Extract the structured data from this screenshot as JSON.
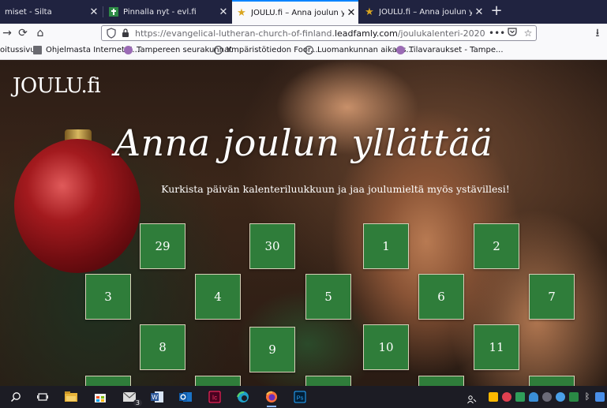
{
  "browser": {
    "tabs": [
      {
        "title": "miset - Silta",
        "icon": "tab-favicon-icon",
        "close": "✕",
        "active": false
      },
      {
        "title": "Pinnalla nyt - evl.fi",
        "icon": "cross-favicon-icon",
        "close": "✕",
        "active": false
      },
      {
        "title": "JOULU.fi – Anna joulun yllättää",
        "icon": "star-favicon-icon",
        "close": "✕",
        "active": true
      },
      {
        "title": "JOULU.fi – Anna joulun yllättää",
        "icon": "star-favicon-icon",
        "close": "✕",
        "active": false
      }
    ],
    "new_tab": "+",
    "url_prefix": "https://evangelical-lutheran-church-of-finland.",
    "url_domain": "leadfamly.com",
    "url_path": "/joulukalenteri-2020",
    "url_more": "•••",
    "bookmarks": [
      {
        "label": "oitussivu",
        "icon": "none"
      },
      {
        "label": "Ohjelmasta Internet E...",
        "icon": "folder-icon"
      },
      {
        "label": "Tampereen seurakunnat",
        "icon": "site-favicon-icon"
      },
      {
        "label": "Ympäristötiedon Foor...",
        "icon": "globe-icon"
      },
      {
        "label": "Luomankunnan aika, s...",
        "icon": "globe-icon"
      },
      {
        "label": "Tilavaraukset - Tampe...",
        "icon": "site-favicon-icon"
      }
    ]
  },
  "page": {
    "logo": "JOULU.fi",
    "title": "Anna joulun yllättää",
    "subtitle": "Kurkista päivän kalenteriluukkuun ja jaa joulumieltä myös ystävillesi!",
    "doors": [
      "29",
      "30",
      "1",
      "2",
      "3",
      "4",
      "5",
      "6",
      "7",
      "8",
      "9",
      "10",
      "11",
      "",
      "",
      "",
      "",
      ""
    ]
  },
  "taskbar": {
    "mail_badge": "3"
  },
  "colors": {
    "door_green": "#2f7d3a",
    "tab_strip": "#202340",
    "active_tab_accent": "#0a84ff"
  }
}
